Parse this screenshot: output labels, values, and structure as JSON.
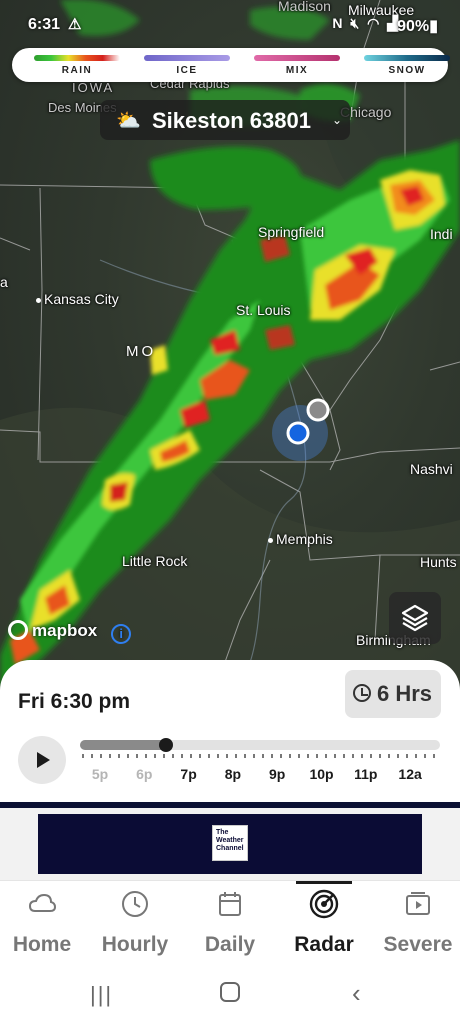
{
  "status_bar": {
    "time": "6:31",
    "battery": "90%",
    "icons": [
      "warning-icon",
      "nfc-icon",
      "mute-icon",
      "wifi-icon",
      "signal-icon",
      "battery-icon"
    ]
  },
  "legend": [
    {
      "label": "RAIN",
      "color": "#2e9e2e"
    },
    {
      "label": "ICE",
      "color": "#8a7fd6"
    },
    {
      "label": "MIX",
      "color": "#d04d8f"
    },
    {
      "label": "SNOW",
      "color": "#2d9fb5"
    }
  ],
  "location": {
    "name": "Sikeston 63801",
    "icon": "partly-cloudy-icon"
  },
  "map": {
    "cities": {
      "madison": "Madison",
      "milwaukee": "Milwaukee",
      "iowa": "IOWA",
      "cedar_rapids": "Cedar Rapids",
      "des_moines": "Des Moines",
      "chicago": "Chicago",
      "springfield": "Springfield",
      "indianapolis": "Indi",
      "kansas_city": "Kansas City",
      "st_louis": "St. Louis",
      "mo": "MO",
      "nashville": "Nashvi",
      "memphis": "Memphis",
      "little_rock": "Little Rock",
      "huntsville": "Hunts",
      "birmingham": "Birmingham",
      "edge_a": "a"
    },
    "attribution": "mapbox"
  },
  "timeline": {
    "datetime": "Fri 6:30 pm",
    "range_button": "6 Hrs",
    "progress": 0.24,
    "hours": [
      "5p",
      "6p",
      "7p",
      "8p",
      "9p",
      "10p",
      "11p",
      "12a"
    ],
    "past_hours": 2
  },
  "ad": {
    "logo_text": "The Weather Channel"
  },
  "nav": [
    {
      "label": "Home",
      "icon": "cloud-icon"
    },
    {
      "label": "Hourly",
      "icon": "clock-icon"
    },
    {
      "label": "Daily",
      "icon": "calendar-icon"
    },
    {
      "label": "Radar",
      "icon": "radar-icon",
      "active": true
    },
    {
      "label": "Severe",
      "icon": "video-icon"
    }
  ],
  "system_nav": [
    "recents-icon",
    "home-circle-icon",
    "back-icon"
  ]
}
